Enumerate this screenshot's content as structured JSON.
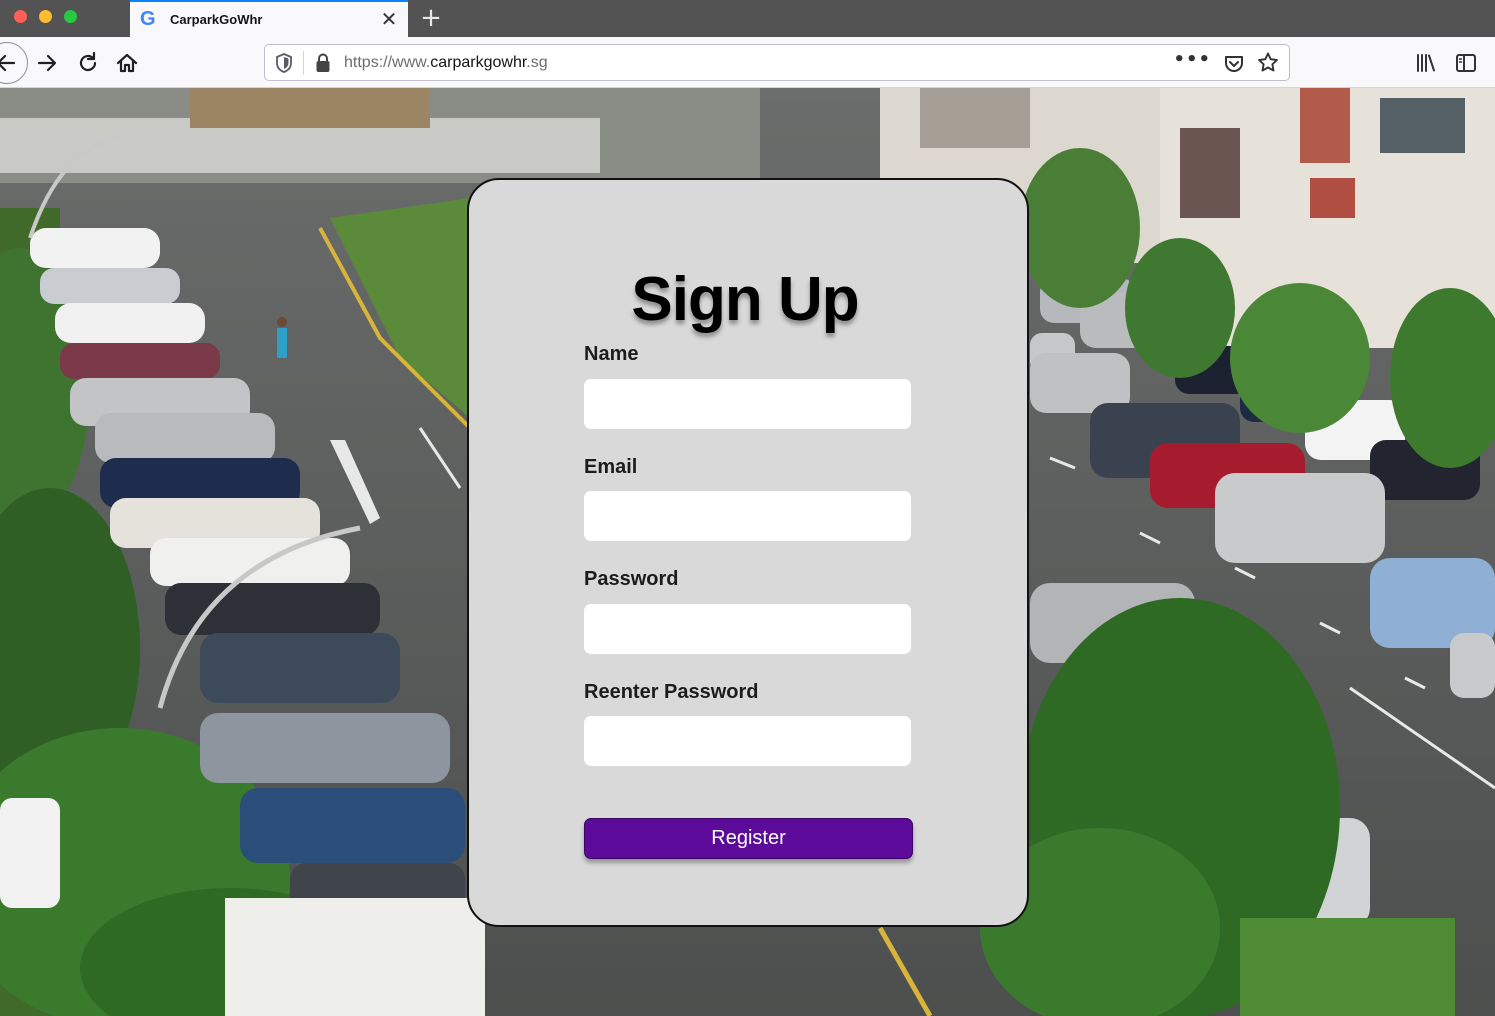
{
  "browser": {
    "tab": {
      "title": "CarparkGoWhr",
      "favicon": "google-g-icon"
    },
    "new_tab_label": "+",
    "url": {
      "prefix": "https://www.",
      "domain": "carparkgowhr",
      "suffix": ".sg"
    },
    "page_actions_label": "•••"
  },
  "signup": {
    "title": "Sign Up",
    "fields": [
      {
        "label": "Name",
        "value": "",
        "placeholder": ""
      },
      {
        "label": "Email",
        "value": "",
        "placeholder": ""
      },
      {
        "label": "Password",
        "value": "",
        "placeholder": ""
      },
      {
        "label": "Reenter Password",
        "value": "",
        "placeholder": ""
      }
    ],
    "register_label": "Register"
  },
  "colors": {
    "card_bg": "#d9d9d9",
    "button_bg": "#5b0a9a",
    "tab_accent": "#0a84ff"
  }
}
